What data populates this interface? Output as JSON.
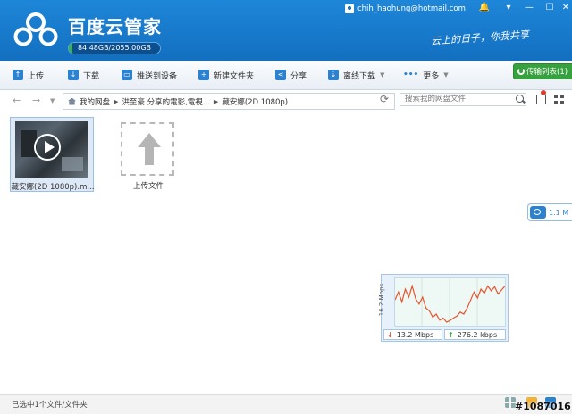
{
  "header": {
    "app_title": "百度云管家",
    "quota_text": "84.48GB/2055.00GB",
    "quota_used_fraction": 0.041,
    "user_email": "chih_haohung@hotmail.com",
    "slogan": "云上的日子，你我共享"
  },
  "toolbar": {
    "upload": "上传",
    "download": "下载",
    "push_to_device": "推送到设备",
    "new_folder": "新建文件夹",
    "share": "分享",
    "offline_download": "离线下载",
    "more": "更多",
    "transfer_list": "传输列表(1)"
  },
  "address": {
    "crumbs": [
      "我的网盘",
      "洪至豪 分享的電影,電視...",
      "藏安娜(2D 1080p)"
    ],
    "search_placeholder": "搜索我的网盘文件"
  },
  "files": {
    "video_name": "藏安娜(2D 1080p).m...",
    "upload_label": "上传文件"
  },
  "side_widget": {
    "speed_text": "1.1 M"
  },
  "speed_graph": {
    "y_label": "16.2 Mbps",
    "download_speed": "13.2 Mbps",
    "upload_speed": "276.2 kbps",
    "line_color": "#e8542e",
    "history": [
      0.55,
      0.75,
      0.5,
      0.82,
      0.62,
      0.9,
      0.58,
      0.45,
      0.62,
      0.35,
      0.28,
      0.12,
      0.2,
      0.05,
      0.1,
      0.0,
      0.04,
      0.1,
      0.15,
      0.25,
      0.2,
      0.35,
      0.55,
      0.75,
      0.6,
      0.82,
      0.72,
      0.9,
      0.78,
      0.88,
      0.7,
      0.8,
      0.9
    ]
  },
  "status": {
    "selection_text": "已选中1个文件/文件夹",
    "watermark": "#1087016"
  }
}
